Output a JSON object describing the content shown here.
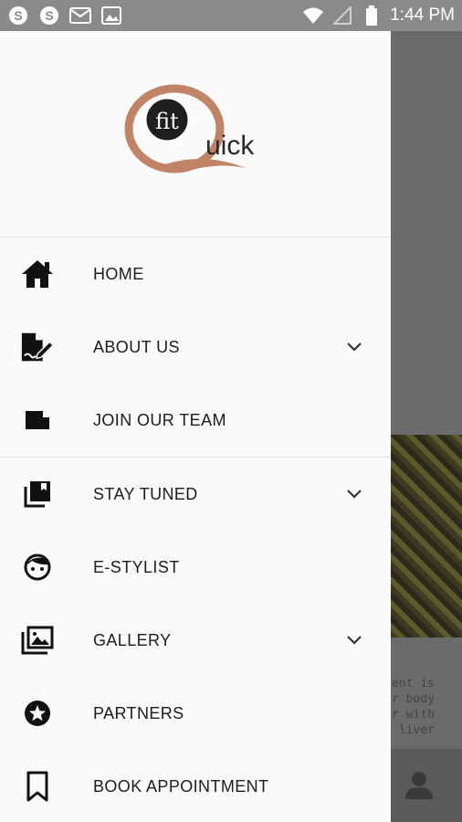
{
  "status_bar": {
    "time": "1:44 PM",
    "left_icons": [
      "skype-icon",
      "skype-icon",
      "gmail-icon",
      "image-icon"
    ],
    "right_icons": [
      "wifi-icon",
      "signal-icon",
      "battery-icon"
    ]
  },
  "drawer": {
    "logo": {
      "main_text": "uick",
      "circle_text": "fit"
    },
    "sections": [
      {
        "items": [
          {
            "label": "HOME",
            "icon": "home-icon",
            "expandable": false
          },
          {
            "label": "ABOUT US",
            "icon": "edit-document-icon",
            "expandable": true
          },
          {
            "label": "JOIN OUR TEAM",
            "icon": "note-icon",
            "expandable": false
          }
        ]
      },
      {
        "items": [
          {
            "label": "STAY TUNED",
            "icon": "library-icon",
            "expandable": true
          },
          {
            "label": "E-STYLIST",
            "icon": "face-icon",
            "expandable": false
          },
          {
            "label": "GALLERY",
            "icon": "photo-library-icon",
            "expandable": true
          },
          {
            "label": "PARTNERS",
            "icon": "star-circle-icon",
            "expandable": false
          },
          {
            "label": "BOOK APPOINTMENT",
            "icon": "bookmark-icon",
            "expandable": false
          }
        ]
      }
    ]
  },
  "background": {
    "text_lines": [
      "ent is",
      "r body",
      "r with",
      "liver"
    ]
  },
  "colors": {
    "logo_copper": "#c18365",
    "drawer_bg": "#fafafa",
    "scrim": "#6f6f6f"
  }
}
